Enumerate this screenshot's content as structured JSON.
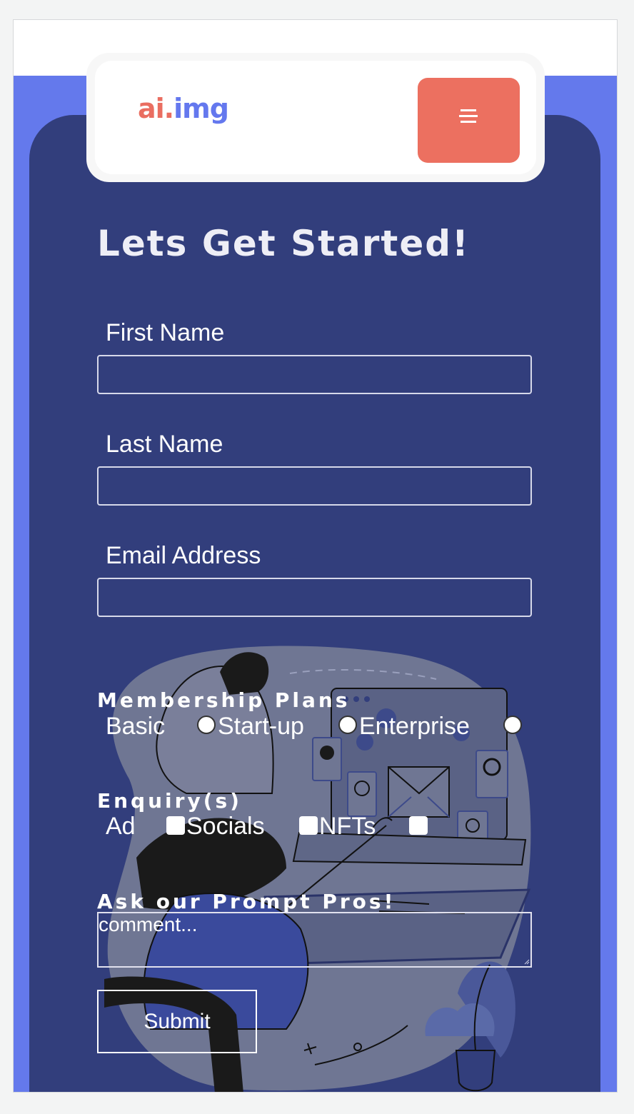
{
  "header": {
    "logo_part1": "ai.",
    "logo_part2": "img",
    "menu_icon": "hamburger-menu-icon"
  },
  "form": {
    "title": "Lets Get Started!",
    "first_name_label": "First Name",
    "last_name_label": "Last Name",
    "email_label": "Email Address",
    "membership_label": "Membership Plans",
    "plans": [
      "Basic",
      "Start-up",
      "Enterprise"
    ],
    "enquiry_label": "Enquiry(s)",
    "enquiries": [
      "Ad",
      "Socials",
      "NFTs"
    ],
    "ask_label": "Ask our Prompt Pros!",
    "comment_placeholder": "comment...",
    "submit_label": "Submit"
  },
  "colors": {
    "page_bg": "#f3f4f4",
    "band": "#6479ec",
    "panel": "#323e7c",
    "accent": "#ec7060",
    "logo_blue": "#6478ee"
  }
}
